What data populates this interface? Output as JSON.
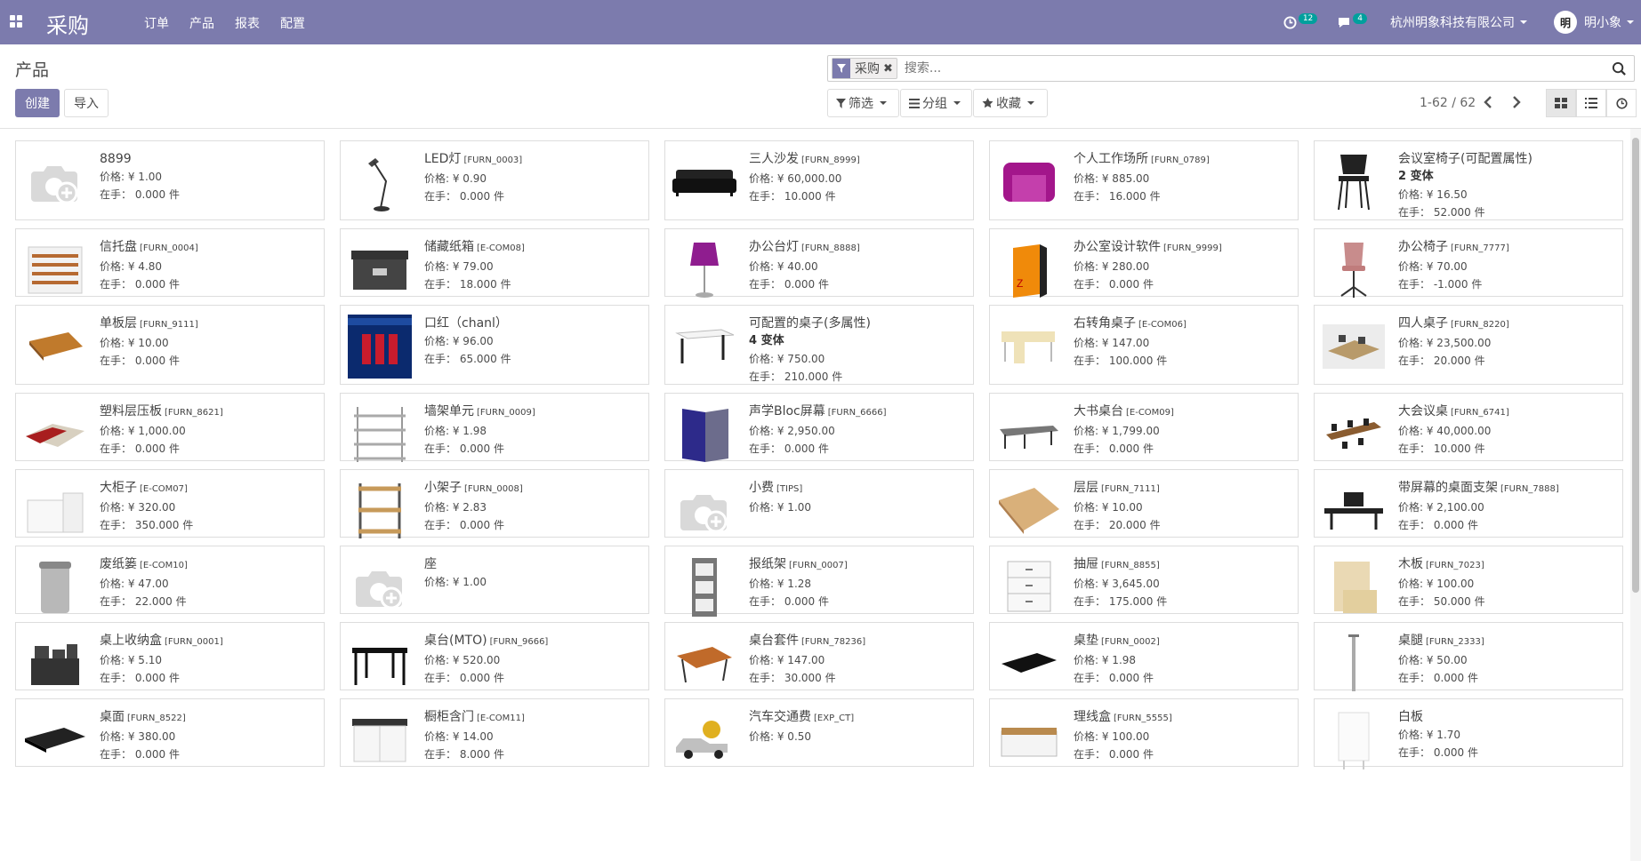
{
  "navbar": {
    "app_title": "采购",
    "menu": [
      "订单",
      "产品",
      "报表",
      "配置"
    ],
    "activity_count": "12",
    "message_count": "4",
    "company": "杭州明象科技有限公司",
    "avatar_text": "明",
    "user": "明小象"
  },
  "control": {
    "breadcrumb": "产品",
    "create_label": "创建",
    "import_label": "导入",
    "facet_label": "采购",
    "facet_remove": "✖",
    "search_placeholder": "搜索...",
    "filter_label": "筛选",
    "group_label": "分组",
    "favorite_label": "收藏",
    "pager": "1-62 / 62"
  },
  "colors": {
    "brand": "#7c7bad",
    "badge": "#00a09d"
  },
  "products": [
    {
      "name": "8899",
      "code": "",
      "price": "价格: ¥ 1.00",
      "onhand": "在手： 0.000 件",
      "thumb": "placeholder"
    },
    {
      "name": "LED灯",
      "code": "[FURN_0003]",
      "price": "价格: ¥ 0.90",
      "onhand": "在手： 0.000 件",
      "thumb": "lamp"
    },
    {
      "name": "三人沙发",
      "code": "[FURN_8999]",
      "price": "价格: ¥ 60,000.00",
      "onhand": "在手： 10.000 件",
      "thumb": "sofa"
    },
    {
      "name": "个人工作场所",
      "code": "[FURN_0789]",
      "price": "价格: ¥ 885.00",
      "onhand": "在手： 16.000 件",
      "thumb": "pod"
    },
    {
      "name": "会议室椅子(可配置属性)",
      "code": "",
      "variants": "2 变体",
      "price": "价格: ¥ 16.50",
      "onhand": "在手： 52.000 件",
      "thumb": "chair-black"
    },
    {
      "name": "信托盘",
      "code": "[FURN_0004]",
      "price": "价格: ¥ 4.80",
      "onhand": "在手： 0.000 件",
      "thumb": "trays"
    },
    {
      "name": "储藏纸箱",
      "code": "[E-COM08]",
      "price": "价格: ¥ 79.00",
      "onhand": "在手： 18.000 件",
      "thumb": "box"
    },
    {
      "name": "办公台灯",
      "code": "[FURN_8888]",
      "price": "价格: ¥ 40.00",
      "onhand": "在手： 0.000 件",
      "thumb": "desklamp"
    },
    {
      "name": "办公室设计软件",
      "code": "[FURN_9999]",
      "price": "价格: ¥ 280.00",
      "onhand": "在手： 0.000 件",
      "thumb": "software"
    },
    {
      "name": "办公椅子",
      "code": "[FURN_7777]",
      "price": "价格: ¥ 70.00",
      "onhand": "在手： -1.000 件",
      "thumb": "chair-pink"
    },
    {
      "name": "单板层",
      "code": "[FURN_9111]",
      "price": "价格: ¥ 10.00",
      "onhand": "在手： 0.000 件",
      "thumb": "plank"
    },
    {
      "name": "口红（chanl）",
      "code": "",
      "price": "价格: ¥ 96.00",
      "onhand": "在手： 65.000 件",
      "thumb": "lipstick"
    },
    {
      "name": "可配置的桌子(多属性)",
      "code": "",
      "variants": "4 变体",
      "price": "价格: ¥ 750.00",
      "onhand": "在手： 210.000 件",
      "thumb": "desk-white"
    },
    {
      "name": "右转角桌子",
      "code": "[E-COM06]",
      "price": "价格: ¥ 147.00",
      "onhand": "在手： 100.000 件",
      "thumb": "corner-desk"
    },
    {
      "name": "四人桌子",
      "code": "[FURN_8220]",
      "price": "价格: ¥ 23,500.00",
      "onhand": "在手： 20.000 件",
      "thumb": "office4"
    },
    {
      "name": "塑料层压板",
      "code": "[FURN_8621]",
      "price": "价格: ¥ 1,000.00",
      "onhand": "在手： 0.000 件",
      "thumb": "laminate"
    },
    {
      "name": "墙架单元",
      "code": "[FURN_0009]",
      "price": "价格: ¥ 1.98",
      "onhand": "在手： 0.000 件",
      "thumb": "wallshelf"
    },
    {
      "name": "声学Bloc屏幕",
      "code": "[FURN_6666]",
      "price": "价格: ¥ 2,950.00",
      "onhand": "在手： 0.000 件",
      "thumb": "screen"
    },
    {
      "name": "大书桌台",
      "code": "[E-COM09]",
      "price": "价格: ¥ 1,799.00",
      "onhand": "在手： 0.000 件",
      "thumb": "bigdesk"
    },
    {
      "name": "大会议桌",
      "code": "[FURN_6741]",
      "price": "价格: ¥ 40,000.00",
      "onhand": "在手： 10.000 件",
      "thumb": "conftable"
    },
    {
      "name": "大柜子",
      "code": "[E-COM07]",
      "price": "价格: ¥ 320.00",
      "onhand": "在手： 350.000 件",
      "thumb": "cabinet"
    },
    {
      "name": "小架子",
      "code": "[FURN_0008]",
      "price": "价格: ¥ 2.83",
      "onhand": "在手： 0.000 件",
      "thumb": "shelf"
    },
    {
      "name": "小费",
      "code": "[TIPS]",
      "price": "价格: ¥ 1.00",
      "onhand": "",
      "thumb": "placeholder"
    },
    {
      "name": "层层",
      "code": "[FURN_7111]",
      "price": "价格: ¥ 10.00",
      "onhand": "在手： 20.000 件",
      "thumb": "plywood"
    },
    {
      "name": "带屏幕的桌面支架",
      "code": "[FURN_7888]",
      "price": "价格: ¥ 2,100.00",
      "onhand": "在手： 0.000 件",
      "thumb": "deskscreen"
    },
    {
      "name": "废纸篓",
      "code": "[E-COM10]",
      "price": "价格: ¥ 47.00",
      "onhand": "在手： 22.000 件",
      "thumb": "bin"
    },
    {
      "name": "座",
      "code": "",
      "price": "价格: ¥ 1.00",
      "onhand": "",
      "thumb": "placeholder"
    },
    {
      "name": "报纸架",
      "code": "[FURN_0007]",
      "price": "价格: ¥ 1.28",
      "onhand": "在手： 0.000 件",
      "thumb": "newsrack"
    },
    {
      "name": "抽屉",
      "code": "[FURN_8855]",
      "price": "价格: ¥ 3,645.00",
      "onhand": "在手： 175.000 件",
      "thumb": "drawer"
    },
    {
      "name": "木板",
      "code": "[FURN_7023]",
      "price": "价格: ¥ 100.00",
      "onhand": "在手： 50.000 件",
      "thumb": "woodboard"
    },
    {
      "name": "桌上收纳盒",
      "code": "[FURN_0001]",
      "price": "价格: ¥ 5.10",
      "onhand": "在手： 0.000 件",
      "thumb": "organizer"
    },
    {
      "name": "桌台(MTO)",
      "code": "[FURN_9666]",
      "price": "价格: ¥ 520.00",
      "onhand": "在手： 0.000 件",
      "thumb": "table-black"
    },
    {
      "name": "桌台套件",
      "code": "[FURN_78236]",
      "price": "价格: ¥ 147.00",
      "onhand": "在手： 30.000 件",
      "thumb": "table-kit"
    },
    {
      "name": "桌垫",
      "code": "[FURN_0002]",
      "price": "价格: ¥ 1.98",
      "onhand": "在手： 0.000 件",
      "thumb": "deskpad"
    },
    {
      "name": "桌腿",
      "code": "[FURN_2333]",
      "price": "价格: ¥ 50.00",
      "onhand": "在手： 0.000 件",
      "thumb": "leg"
    },
    {
      "name": "桌面",
      "code": "[FURN_8522]",
      "price": "价格: ¥ 380.00",
      "onhand": "在手： 0.000 件",
      "thumb": "tabletop"
    },
    {
      "name": "橱柜含门",
      "code": "[E-COM11]",
      "price": "价格: ¥ 14.00",
      "onhand": "在手： 8.000 件",
      "thumb": "cupboard"
    },
    {
      "name": "汽车交通费",
      "code": "[EXP_CT]",
      "price": "价格: ¥ 0.50",
      "onhand": "",
      "thumb": "car"
    },
    {
      "name": "理线盒",
      "code": "[FURN_5555]",
      "price": "价格: ¥ 100.00",
      "onhand": "在手： 0.000 件",
      "thumb": "cablebox"
    },
    {
      "name": "白板",
      "code": "",
      "price": "价格: ¥ 1.70",
      "onhand": "在手： 0.000 件",
      "thumb": "whiteboard"
    }
  ]
}
